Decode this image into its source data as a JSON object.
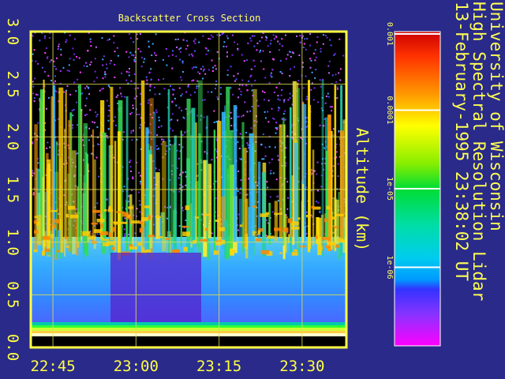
{
  "chart_data": {
    "type": "heatmap",
    "title": "Backscatter Cross Section",
    "ylabel": "Altitude (km)",
    "xlabel": "",
    "y_ticks": [
      "0.0",
      "0.5",
      "1.0",
      "1.5",
      "2.0",
      "2.5",
      "3.0"
    ],
    "ylim": [
      0,
      3.0
    ],
    "x_ticks": [
      "22:45",
      "23:00",
      "23:15",
      "23:30"
    ],
    "xlim": [
      "22:41",
      "23:38"
    ],
    "grid": true,
    "colorbar": {
      "scale": "log",
      "range": [
        1e-07,
        0.001
      ],
      "ticks": [
        "0.001",
        "0.0001",
        "1e-05",
        "1e-06"
      ]
    },
    "side_text": [
      "University of Wisconsin",
      "High Spectral Resolution Lidar",
      "13-February-1995 23:38:02 UT"
    ]
  },
  "colors": {
    "background": "#2a2a8a",
    "frame": "#ffff44",
    "text": "#ffff44"
  }
}
